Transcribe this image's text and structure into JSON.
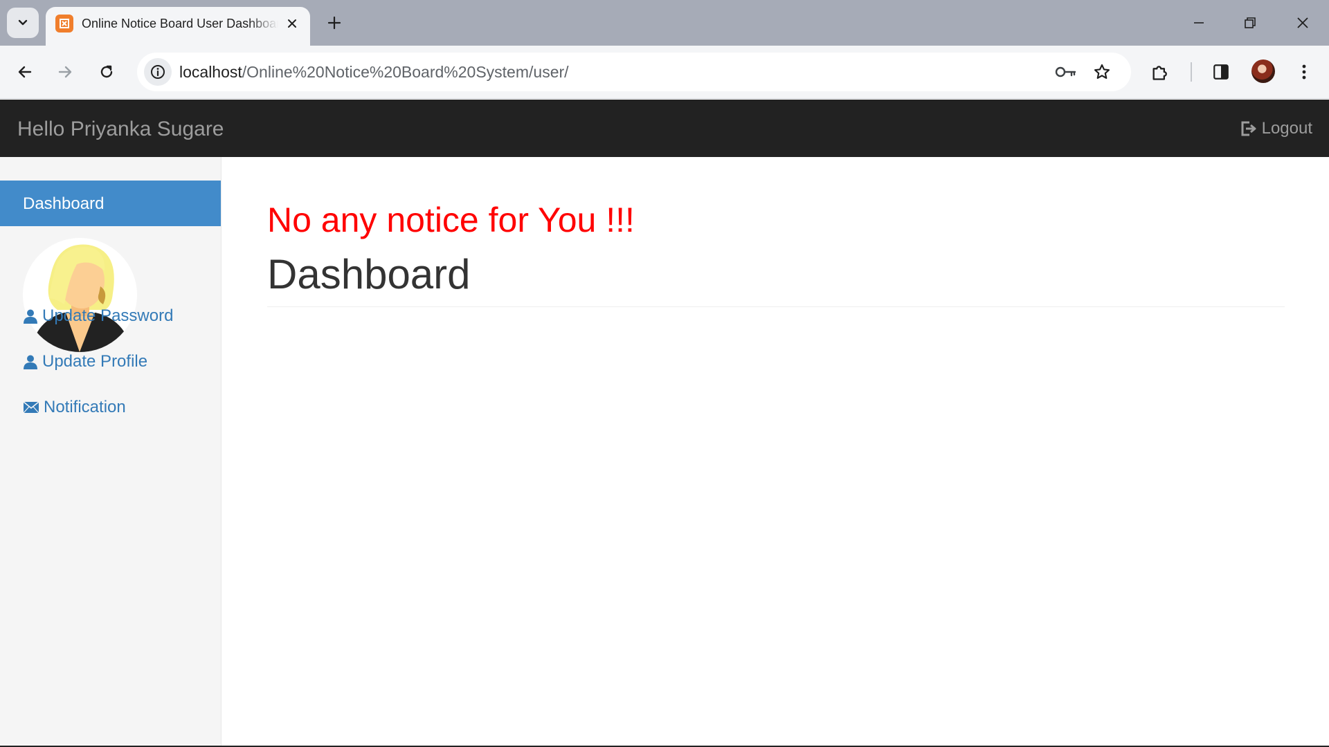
{
  "browser": {
    "tab_title": "Online Notice Board User Dashboard",
    "url_host": "localhost",
    "url_path": "/Online%20Notice%20Board%20System/user/",
    "icons": {
      "tab_list": "chevron-down-icon",
      "favicon": "xampp-icon",
      "tab_close": "close-icon",
      "new_tab": "plus-icon",
      "minimize": "minimize-icon",
      "restore": "restore-icon",
      "close": "close-icon",
      "back": "arrow-left-icon",
      "forward": "arrow-right-icon",
      "reload": "reload-icon",
      "site_info": "info-icon",
      "password": "key-icon",
      "bookmark": "star-icon",
      "extensions": "puzzle-icon",
      "side_panel": "side-panel-icon",
      "menu": "kebab-menu-icon"
    }
  },
  "navbar": {
    "brand": "Hello Priyanka Sugare",
    "logout_label": "Logout",
    "background": "#222222",
    "text_color": "#9d9d9d"
  },
  "sidebar": {
    "active_item": "Dashboard",
    "active_color": "#428bca",
    "links": [
      {
        "label": "Update Password",
        "icon": "user-icon"
      },
      {
        "label": "Update Profile",
        "icon": "user-icon"
      },
      {
        "label": "Notification",
        "icon": "envelope-icon"
      }
    ],
    "link_color": "#337ab7"
  },
  "main": {
    "notice_text": "No any notice for You !!!",
    "notice_color": "#ff0000",
    "page_title": "Dashboard"
  }
}
